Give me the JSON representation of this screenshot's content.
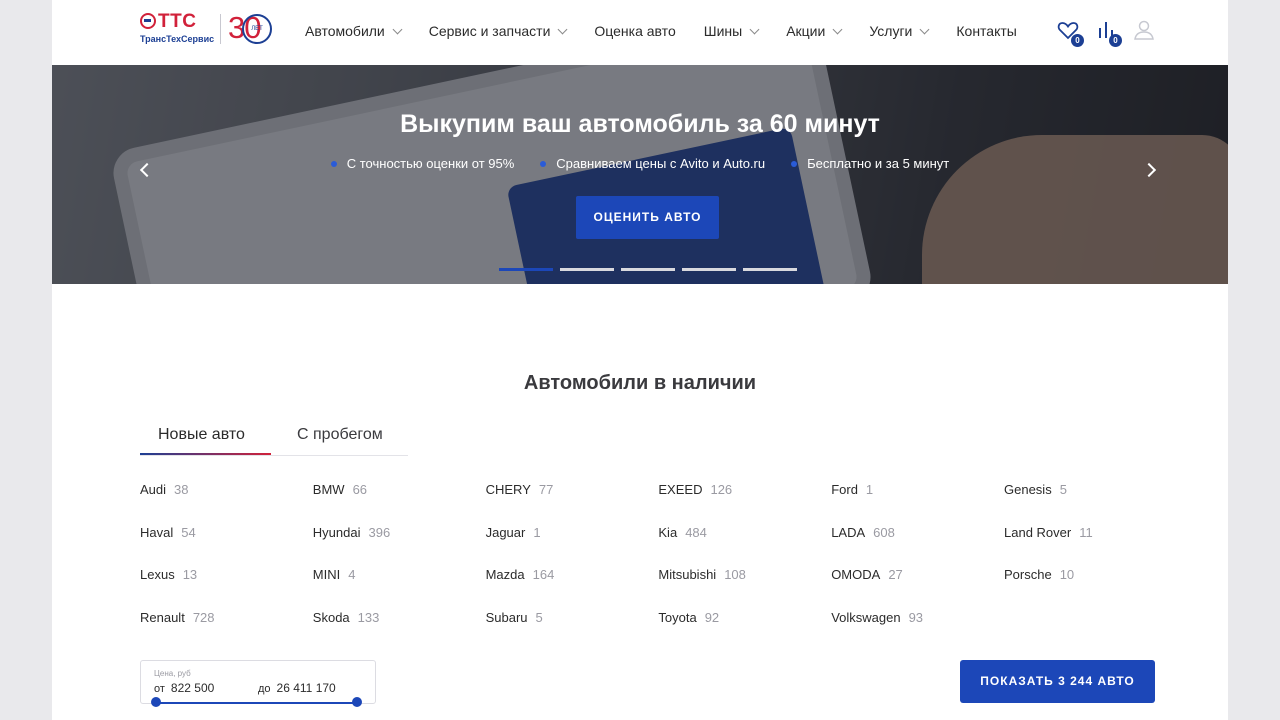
{
  "header": {
    "logo_text": "ТТС",
    "logo_subtext": "ТрансТехСервис",
    "anniversary_number": "30",
    "anniversary_label": "ЛЕТ",
    "nav": [
      {
        "label": "Автомобили",
        "dropdown": true
      },
      {
        "label": "Сервис и запчасти",
        "dropdown": true
      },
      {
        "label": "Оценка авто",
        "dropdown": false
      },
      {
        "label": "Шины",
        "dropdown": true
      },
      {
        "label": "Акции",
        "dropdown": true
      },
      {
        "label": "Услуги",
        "dropdown": true
      },
      {
        "label": "Контакты",
        "dropdown": false
      }
    ],
    "favorites_count": "0",
    "compare_count": "0"
  },
  "hero": {
    "title": "Выкупим ваш автомобиль за 60 минут",
    "points": [
      "С точностью оценки от 95%",
      "Сравниваем цены с Avito и Auto.ru",
      "Бесплатно и за 5 минут"
    ],
    "button_label": "ОЦЕНИТЬ АВТО",
    "slides_total": 5,
    "active_slide": 1
  },
  "catalog": {
    "title": "Автомобили в наличии",
    "tabs": [
      "Новые авто",
      "С пробегом"
    ],
    "active_tab": 0,
    "brands": [
      {
        "name": "Audi",
        "count": "38"
      },
      {
        "name": "BMW",
        "count": "66"
      },
      {
        "name": "CHERY",
        "count": "77"
      },
      {
        "name": "EXEED",
        "count": "126"
      },
      {
        "name": "Ford",
        "count": "1"
      },
      {
        "name": "Genesis",
        "count": "5"
      },
      {
        "name": "Haval",
        "count": "54"
      },
      {
        "name": "Hyundai",
        "count": "396"
      },
      {
        "name": "Jaguar",
        "count": "1"
      },
      {
        "name": "Kia",
        "count": "484"
      },
      {
        "name": "LADA",
        "count": "608"
      },
      {
        "name": "Land Rover",
        "count": "11"
      },
      {
        "name": "Lexus",
        "count": "13"
      },
      {
        "name": "MINI",
        "count": "4"
      },
      {
        "name": "Mazda",
        "count": "164"
      },
      {
        "name": "Mitsubishi",
        "count": "108"
      },
      {
        "name": "OMODA",
        "count": "27"
      },
      {
        "name": "Porsche",
        "count": "10"
      },
      {
        "name": "Renault",
        "count": "728"
      },
      {
        "name": "Skoda",
        "count": "133"
      },
      {
        "name": "Subaru",
        "count": "5"
      },
      {
        "name": "Toyota",
        "count": "92"
      },
      {
        "name": "Volkswagen",
        "count": "93"
      }
    ],
    "price": {
      "label": "Цена, руб",
      "from_label": "от",
      "from_value": "822 500",
      "to_label": "до",
      "to_value": "26 411 170"
    },
    "show_button_label": "ПОКАЗАТЬ 3 244 АВТО"
  },
  "colors": {
    "accent": "#1c47b8",
    "brand_red": "#d1213a",
    "brand_blue": "#1c3f94"
  }
}
